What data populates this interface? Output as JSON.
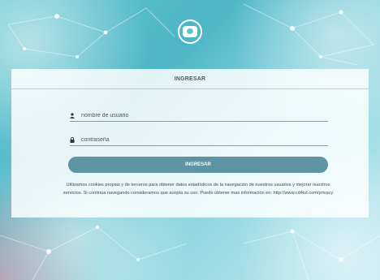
{
  "colors": {
    "accent": "#5e94a4",
    "background": "#5fc3cf"
  },
  "logo": {
    "icon": "cd-logo-icon"
  },
  "login": {
    "title": "INGRESAR",
    "username": {
      "icon": "user-icon",
      "placeholder": "nombre de usuario",
      "value": ""
    },
    "password": {
      "icon": "lock-icon",
      "placeholder": "contraseña",
      "value": ""
    },
    "submit_label": "INGRESAR",
    "cookie_notice": "Utilizamos cookies propias y de terceros para obtener datos estadísticos de la navegación de nuestros usuarios y mejorar nuestros servicios. Si continua navegando consideramos que acepta su uso. Puede obtener mas información en: http://www.cd4iot.com/privacy"
  }
}
